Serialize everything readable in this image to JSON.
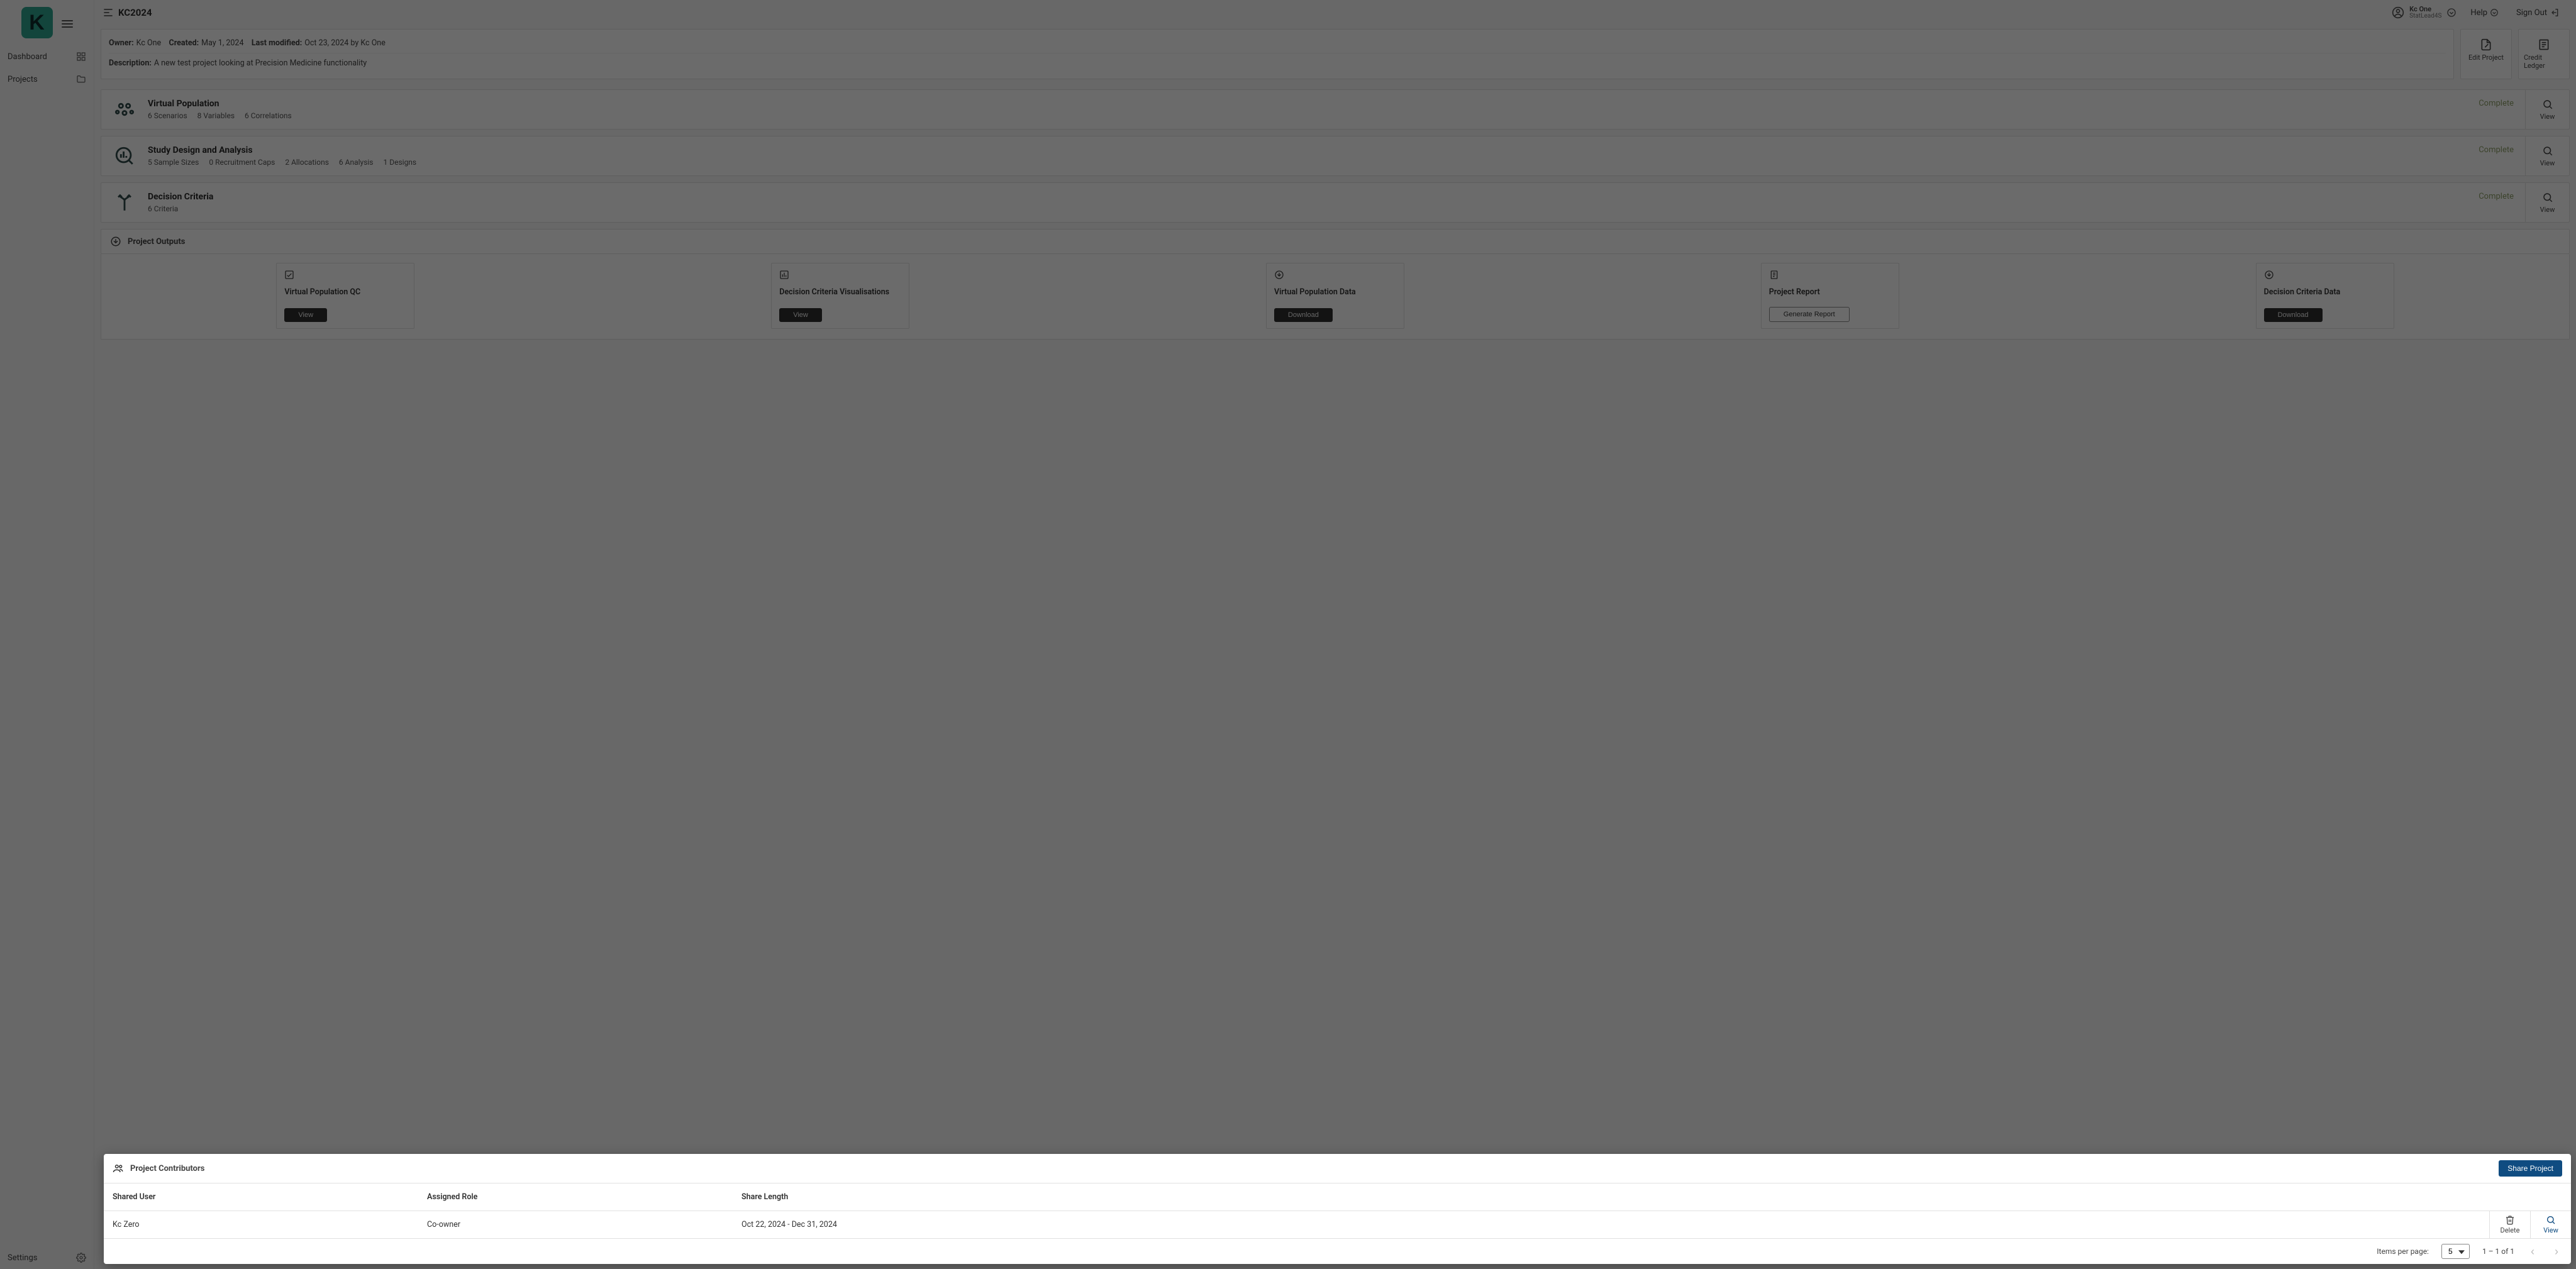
{
  "app": {
    "logo_letter": "K",
    "title": "KC2024"
  },
  "sidebar": {
    "items": [
      {
        "label": "Dashboard"
      },
      {
        "label": "Projects"
      }
    ],
    "bottom": {
      "label": "Settings"
    }
  },
  "topbar": {
    "user_name": "Kc One",
    "user_role": "StatLead4S",
    "help": "Help",
    "signout": "Sign Out"
  },
  "meta": {
    "owner_label": "Owner:",
    "owner": "Kc One",
    "created_label": "Created:",
    "created": "May 1, 2024",
    "modified_label": "Last modified:",
    "modified": "Oct 23, 2024 by Kc One",
    "desc_label": "Description:",
    "desc": "A new test project looking at Precision Medicine functionality",
    "actions": {
      "edit": "Edit Project",
      "ledger": "Credit Ledger"
    }
  },
  "rows": [
    {
      "title": "Virtual Population",
      "subs": [
        "6 Scenarios",
        "8 Variables",
        "6 Correlations"
      ],
      "status": "Complete",
      "view": "View"
    },
    {
      "title": "Study Design and Analysis",
      "subs": [
        "5 Sample Sizes",
        "0 Recruitment Caps",
        "2 Allocations",
        "6 Analysis",
        "1 Designs"
      ],
      "status": "Complete",
      "view": "View"
    },
    {
      "title": "Decision Criteria",
      "subs": [
        "6 Criteria"
      ],
      "status": "Complete",
      "view": "View"
    }
  ],
  "outputs": {
    "header": "Project Outputs",
    "cards": [
      {
        "title": "Virtual Population QC",
        "button": "View",
        "style": "dark"
      },
      {
        "title": "Decision Criteria Visualisations",
        "button": "View",
        "style": "dark"
      },
      {
        "title": "Virtual Population Data",
        "button": "Download",
        "style": "dark"
      },
      {
        "title": "Project Report",
        "button": "Generate Report",
        "style": "outline"
      },
      {
        "title": "Decision Criteria Data",
        "button": "Download",
        "style": "dark"
      }
    ]
  },
  "contrib": {
    "header": "Project Contributors",
    "share": "Share Project",
    "columns": {
      "user": "Shared User",
      "role": "Assigned Role",
      "len": "Share Length"
    },
    "rows": [
      {
        "user": "Kc Zero",
        "role": "Co-owner",
        "len": "Oct 22, 2024 - Dec 31, 2024"
      }
    ],
    "actions": {
      "delete": "Delete",
      "view": "View"
    },
    "footer": {
      "ipp_label": "Items per page:",
      "ipp_value": "5",
      "range": "1 – 1 of 1"
    }
  }
}
